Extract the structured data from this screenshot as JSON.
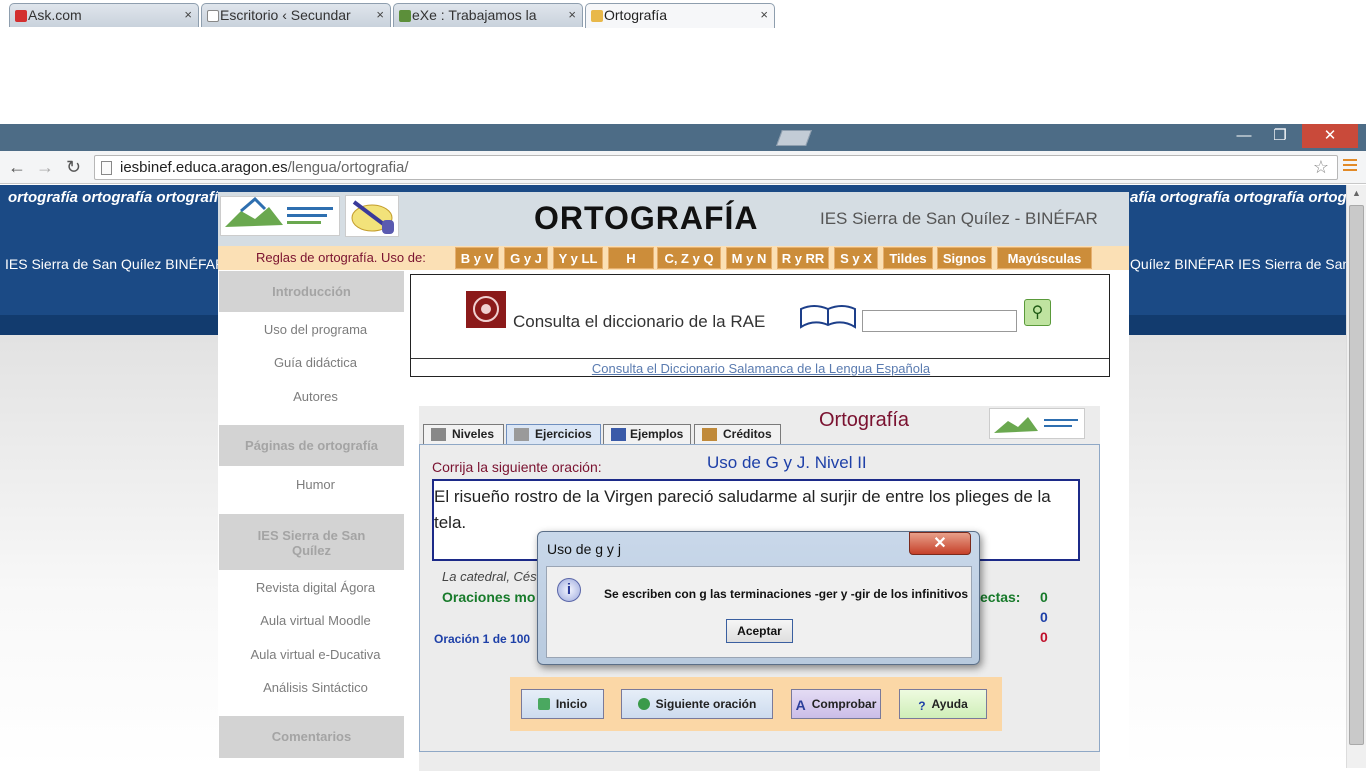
{
  "browser": {
    "tabs": [
      {
        "title": "Ask.com",
        "favicon": "ask-icon"
      },
      {
        "title": "Escritorio ‹ Secundar",
        "favicon": "page-icon"
      },
      {
        "title": "eXe : Trabajamos la",
        "favicon": "exe-icon"
      },
      {
        "title": "Ortografía",
        "favicon": "ortografia-icon"
      }
    ],
    "tab_close": "×",
    "url_domain": "iesbinef.educa.aragon.es",
    "url_path": "/lengua/ortografia/",
    "window_buttons": {
      "minimize": "—",
      "restore": "❐",
      "close": "✕"
    }
  },
  "background": {
    "band_top": "ortografía ortografía ortografía ortografía ortografía ortografía ortografía ortografía ortografía ortografía ortografía ortografía ortografía",
    "band_top_right": "afía ortografía    ortografía ortografía",
    "band_bottom": "IES Sierra de San Quílez BINÉFAR",
    "band_bottom_right": "Quílez BINÉFAR    IES Sierra de San Quílez BINÉFAR"
  },
  "header": {
    "title": "ORTOGRAFÍA",
    "school": "IES Sierra de San Quílez - BINÉFAR"
  },
  "rules": {
    "label": "Reglas de ortografía. Uso de:",
    "buttons": [
      "B y V",
      "G y J",
      "Y y LL",
      "H",
      "C, Z y Q",
      "M y N",
      "R y RR",
      "S y X",
      "Tildes",
      "Signos",
      "Mayúsculas"
    ]
  },
  "sidebar": {
    "intro_head": "Introducción",
    "intro_links": [
      "Uso del programa",
      "Guía didáctica",
      "Autores"
    ],
    "paginas_head": "Páginas de ortografía",
    "paginas_links": [
      "Humor"
    ],
    "ies_head": "IES Sierra de San Quílez",
    "ies_links": [
      "Revista digital Ágora",
      "Aula virtual Moodle",
      "Aula virtual e-Ducativa",
      "Análisis Sintáctico"
    ],
    "comentarios_head": "Comentarios"
  },
  "rae": {
    "label": "Consulta el diccionario de la RAE",
    "search_value": "",
    "salamanca_link": "Consulta el Diccionario Salamanca de la Lengua Española"
  },
  "app": {
    "tabs": [
      "Niveles",
      "Ejercicios",
      "Ejemplos",
      "Créditos"
    ],
    "title": "Ortografía",
    "instruction": "Corrija la siguiente oración:",
    "level": "Uso de G y J. Nivel II",
    "sentence": "El risueño rostro de la Virgen pareció saludarme al surjir de entre los plieges de la tela.",
    "source": "La catedral, Cés",
    "oraciones_label": "Oraciones mo",
    "correctas_label": "ectas:",
    "scores": [
      "0",
      "0",
      "0"
    ],
    "oracion_counter": "Oración 1 de  100",
    "buttons": {
      "inicio": "Inicio",
      "siguiente": "Siguiente oración",
      "comprobar": "Comprobar",
      "ayuda": "Ayuda"
    },
    "colors": {
      "correct": "#177a2a",
      "neutral": "#1e40a8",
      "wrong": "#c0102a"
    }
  },
  "dialog": {
    "title": "Uso de g y j",
    "close": "✕",
    "info_glyph": "i",
    "message": "Se escriben con g las terminaciones -ger y -gir de los infinitivos",
    "ok": "Aceptar"
  }
}
